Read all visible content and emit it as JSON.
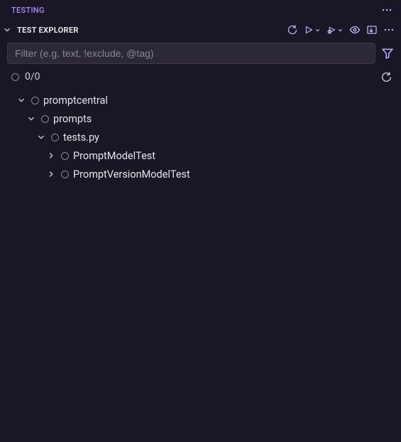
{
  "panel": {
    "title": "TESTING"
  },
  "section": {
    "title": "TEST EXPLORER"
  },
  "filter": {
    "placeholder": "Filter (e.g. text, !exclude, @tag)",
    "value": ""
  },
  "status": {
    "counts": "0/0"
  },
  "tree": {
    "items": [
      {
        "label": "promptcentral",
        "depth": 0,
        "expanded": true
      },
      {
        "label": "prompts",
        "depth": 1,
        "expanded": true
      },
      {
        "label": "tests.py",
        "depth": 2,
        "expanded": true
      },
      {
        "label": "PromptModelTest",
        "depth": 3,
        "expanded": false
      },
      {
        "label": "PromptVersionModelTest",
        "depth": 3,
        "expanded": false
      }
    ]
  }
}
